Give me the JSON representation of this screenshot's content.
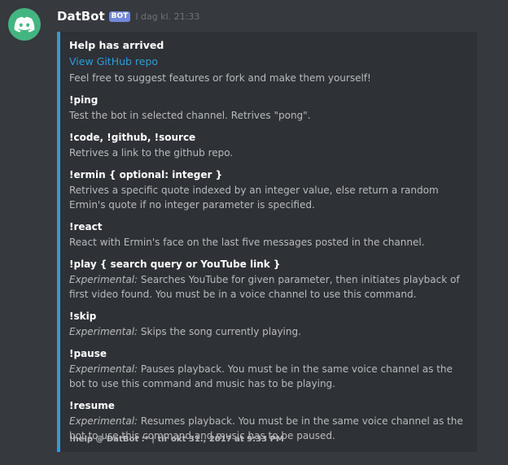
{
  "author": {
    "name": "DatBot",
    "bot_tag": "BOT",
    "timestamp": "I dag kl. 21:33",
    "avatar_icon": "discord-logo-icon"
  },
  "embed": {
    "accent_color": "#3498db",
    "title": "Help has arrived",
    "link_text": "View GitHub repo",
    "description": "Feel free to suggest features or fork and make them yourself!",
    "fields": [
      {
        "name": "!ping",
        "prefix": "",
        "value": "Test the bot in selected channel. Retrives \"pong\"."
      },
      {
        "name": "!code, !github, !source",
        "prefix": "",
        "value": "Retrives a link to the github repo."
      },
      {
        "name": "!ermin { optional: integer }",
        "prefix": "",
        "value": "Retrives a specific quote indexed by an integer value, else return a random Ermin's quote if no integer parameter is specified."
      },
      {
        "name": "!react",
        "prefix": "",
        "value": "React with Ermin's face on the last five messages posted in the channel."
      },
      {
        "name": "!play { search query or YouTube link }",
        "prefix": "Experimental:",
        "value": " Searches YouTube for given parameter, then initiates playback of first video found. You must be in a voice channel to use this command."
      },
      {
        "name": "!skip",
        "prefix": "Experimental:",
        "value": " Skips the song currently playing."
      },
      {
        "name": "!pause",
        "prefix": "Experimental:",
        "value": " Pauses playback. You must be in the same voice channel as the bot to use this command and music has to be playing."
      },
      {
        "name": "!resume",
        "prefix": "Experimental:",
        "value": " Resumes playback. You must be in the same voice channel as the bot to use this command and music has to be paused."
      }
    ],
    "footer": "!help @ DatBot :* | tir okt 31., 2017 at 9:33 PM"
  }
}
